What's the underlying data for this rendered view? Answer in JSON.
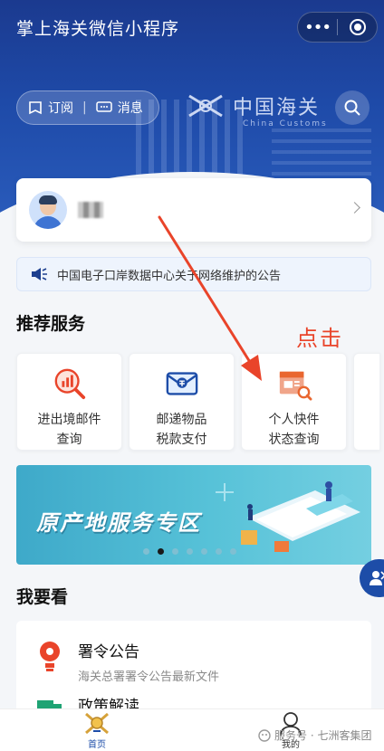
{
  "header": {
    "app_title": "掌上海关微信小程序",
    "capsule_more": "•••",
    "subscribe": "订阅",
    "messages": "消息",
    "divider": "|",
    "logo_text": "中国海关",
    "logo_sub": "China Customs"
  },
  "notice": {
    "text": "中国电子口岸数据中心关于网络维护的公告"
  },
  "recommended": {
    "title": "推荐服务",
    "annotation": "点击",
    "services": [
      {
        "line1": "进出境邮件",
        "line2": "查询",
        "icon": "mail-chart-search-icon"
      },
      {
        "line1": "邮递物品",
        "line2": "税款支付",
        "icon": "envelope-tax-icon"
      },
      {
        "line1": "个人快件",
        "line2": "状态查询",
        "icon": "package-search-icon"
      }
    ]
  },
  "banner": {
    "text": "原产地服务专区",
    "active_dot": 2,
    "dot_count": 7
  },
  "watch": {
    "title": "我要看",
    "items": [
      {
        "title": "署令公告",
        "subtitle": "海关总署署令公告最新文件",
        "icon": "lightbulb-icon"
      },
      {
        "title": "政策解读",
        "icon": "truck-icon"
      }
    ]
  },
  "tabbar": {
    "home": "首页",
    "mine": "我的"
  },
  "watermark": {
    "text": "服务号 · 七洲客集团"
  },
  "colors": {
    "brand": "#1d4da8",
    "accent": "#e9442a",
    "banner": "#57c2d8"
  }
}
